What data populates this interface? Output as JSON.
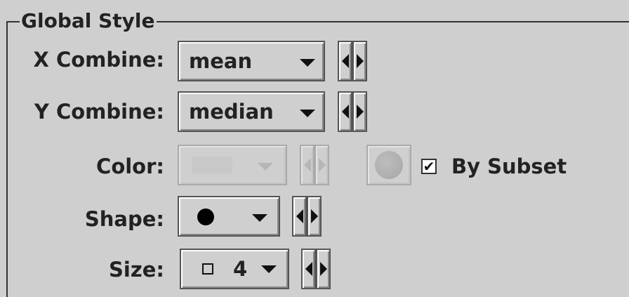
{
  "panel": {
    "title": "Global Style"
  },
  "x_combine": {
    "label": "X Combine:",
    "value": "mean"
  },
  "y_combine": {
    "label": "Y Combine:",
    "value": "median"
  },
  "color": {
    "label": "Color:",
    "by_subset_label": "By Subset",
    "by_subset_checked": "✔"
  },
  "shape": {
    "label": "Shape:",
    "value_icon": "filled-circle-icon"
  },
  "size": {
    "label": "Size:",
    "value": "4",
    "value_icon": "hollow-square-icon"
  }
}
